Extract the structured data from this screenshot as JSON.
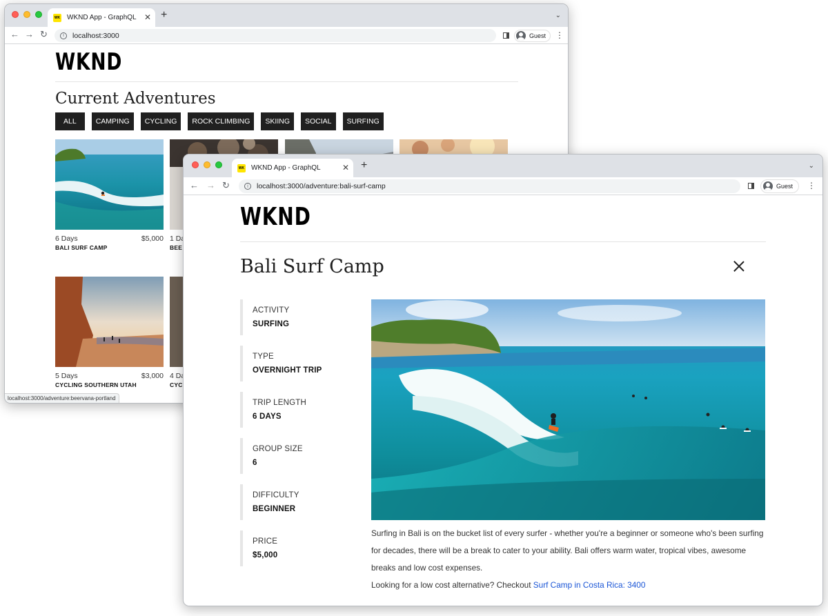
{
  "window1": {
    "tab_title": "WKND App - GraphQL",
    "favicon_text": "WK",
    "url": "localhost:3000",
    "guest_label": "Guest",
    "logo": "WKND",
    "heading": "Current Adventures",
    "filters": [
      "ALL",
      "CAMPING",
      "CYCLING",
      "ROCK CLIMBING",
      "SKIING",
      "SOCIAL",
      "SURFING"
    ],
    "cards": [
      {
        "days": "6 Days",
        "price": "$5,000",
        "title": "BALI SURF CAMP"
      },
      {
        "days": "1 Da",
        "price": "",
        "title": "BEE"
      },
      {
        "days": "5 Days",
        "price": "$3,000",
        "title": "CYCLING SOUTHERN UTAH"
      },
      {
        "days": "4 Da",
        "price": "",
        "title": "CYC"
      }
    ],
    "status_url": "localhost:3000/adventure:beervana-portland"
  },
  "window2": {
    "tab_title": "WKND App - GraphQL",
    "favicon_text": "WK",
    "url": "localhost:3000/adventure:bali-surf-camp",
    "guest_label": "Guest",
    "logo": "WKND",
    "title": "Bali Surf Camp",
    "details": [
      {
        "label": "ACTIVITY",
        "value": "SURFING"
      },
      {
        "label": "TYPE",
        "value": "OVERNIGHT TRIP"
      },
      {
        "label": "TRIP LENGTH",
        "value": "6 DAYS"
      },
      {
        "label": "GROUP SIZE",
        "value": "6"
      },
      {
        "label": "DIFFICULTY",
        "value": "BEGINNER"
      },
      {
        "label": "PRICE",
        "value": "$5,000"
      }
    ],
    "description": "Surfing in Bali is on the bucket list of every surfer - whether you're a beginner or someone who's been surfing for decades, there will be a break to cater to your ability. Bali offers warm water, tropical vibes, awesome breaks and low cost expenses.",
    "alt_prefix": "Looking for a low cost alternative? Checkout ",
    "alt_link": "Surf Camp in Costa Rica: 3400"
  },
  "colors": {
    "tabbar": "#dee1e6",
    "filter_bg": "#202020",
    "link": "#1a55d6",
    "favicon": "#ffe500"
  }
}
